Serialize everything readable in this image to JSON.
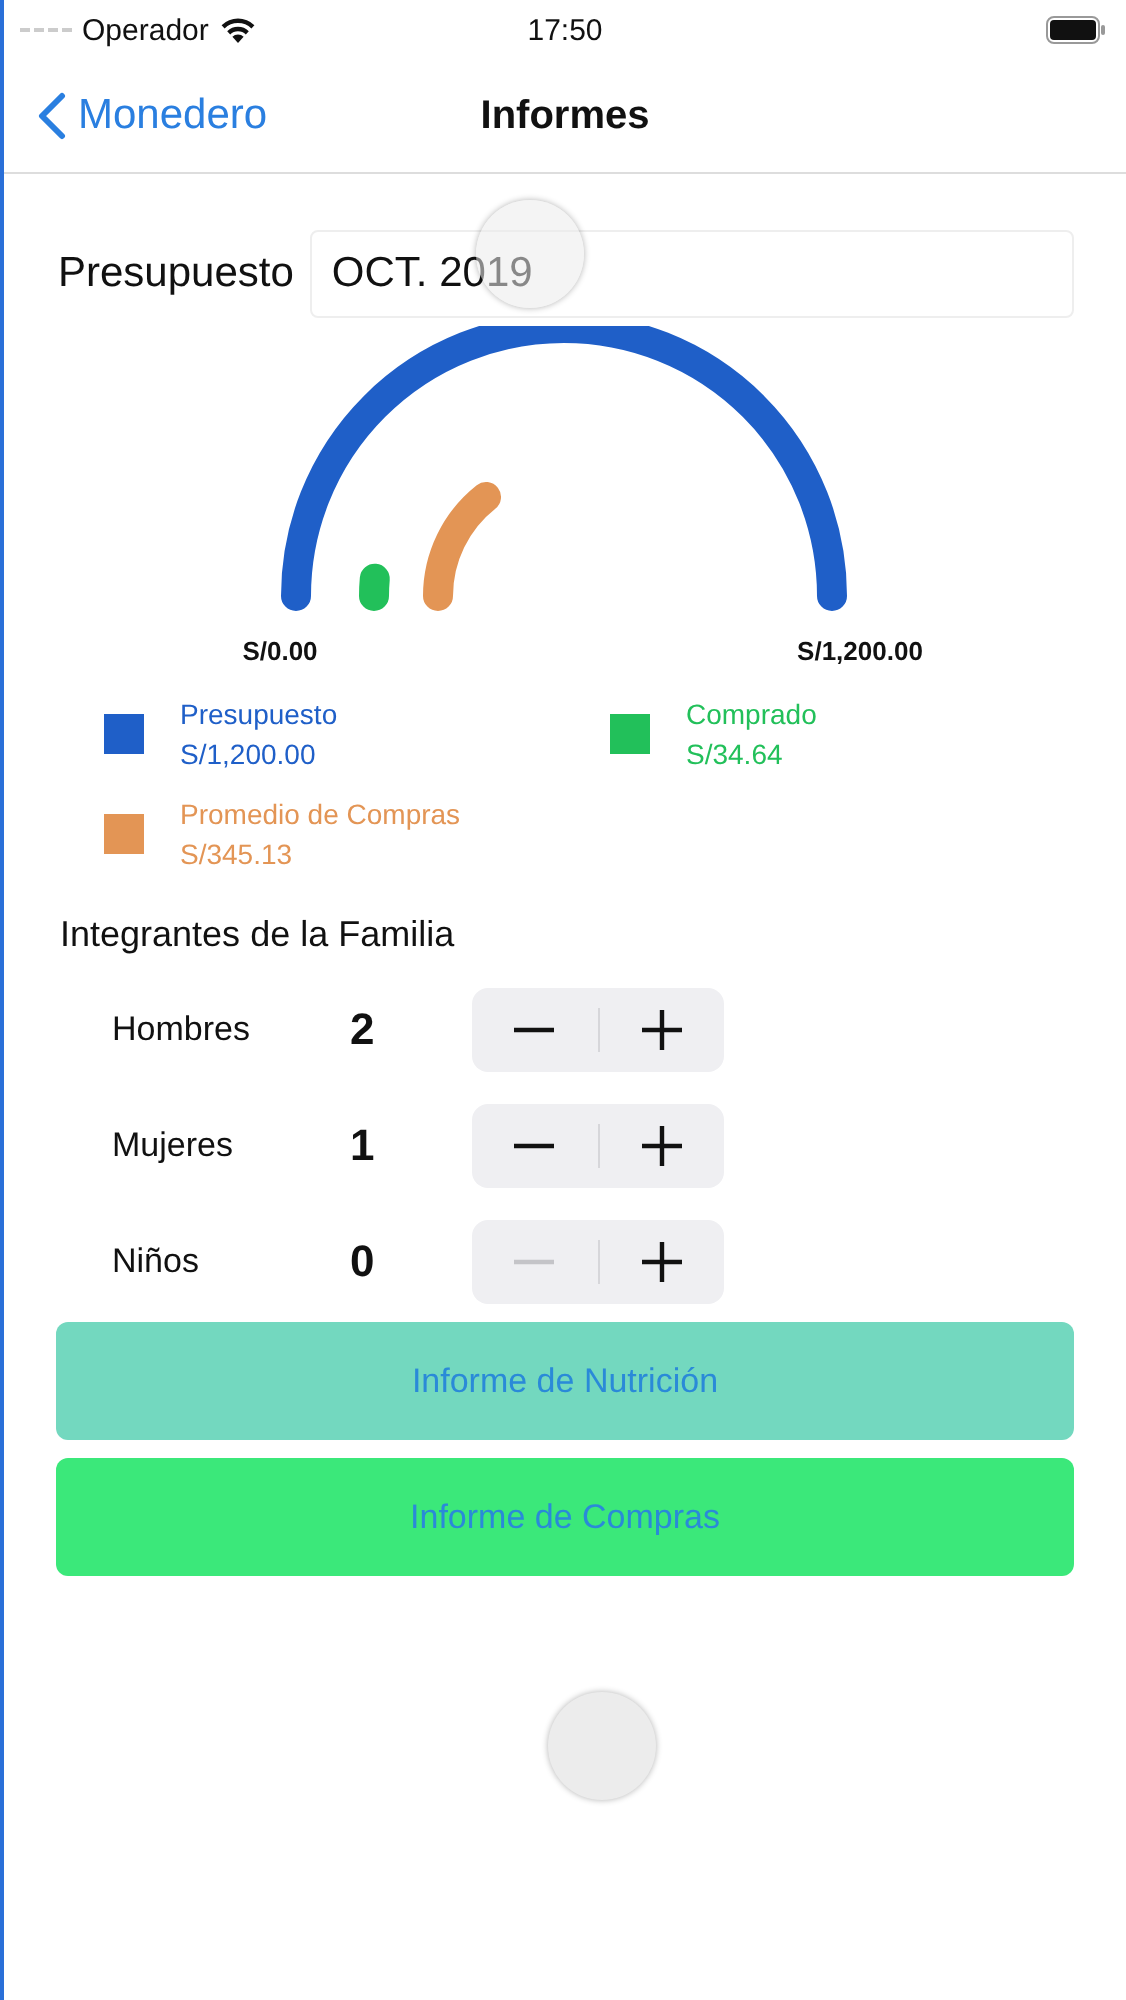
{
  "status_bar": {
    "carrier": "Operador",
    "time": "17:50"
  },
  "nav": {
    "back": "Monedero",
    "title": "Informes"
  },
  "budget": {
    "label": "Presupuesto",
    "value": "OCT. 2019"
  },
  "gauge": {
    "min_label": "S/0.00",
    "max_label": "S/1,200.00",
    "series": [
      {
        "name": "Presupuesto",
        "amount": "S/1,200.00",
        "color": "#1f5fc8"
      },
      {
        "name": "Comprado",
        "amount": "S/34.64",
        "color": "#22c05a"
      },
      {
        "name": "Promedio de Compras",
        "amount": "S/345.13",
        "color": "#e39555"
      }
    ]
  },
  "family": {
    "title": "Integrantes de la Familia",
    "members": [
      {
        "label": "Hombres",
        "count": "2",
        "minus_disabled": false
      },
      {
        "label": "Mujeres",
        "count": "1",
        "minus_disabled": false
      },
      {
        "label": "Niños",
        "count": "0",
        "minus_disabled": true
      }
    ]
  },
  "buttons": [
    {
      "label": "Informe de Nutrición",
      "kind": "nutrition"
    },
    {
      "label": "Informe de Compras",
      "kind": "purchases"
    }
  ]
}
